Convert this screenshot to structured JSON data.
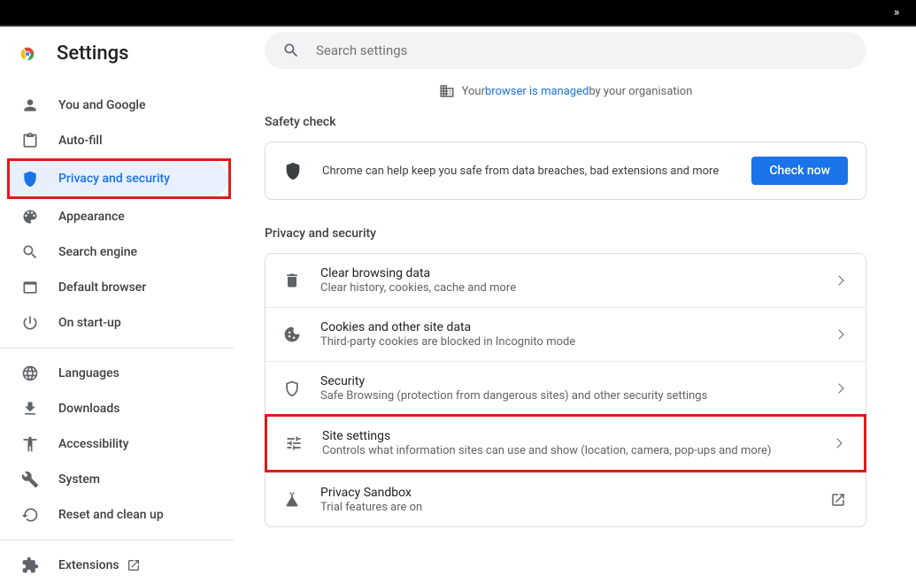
{
  "topbar": {
    "expand": "»"
  },
  "sidebar": {
    "title": "Settings",
    "items": [
      {
        "label": "You and Google"
      },
      {
        "label": "Auto-fill"
      },
      {
        "label": "Privacy and security"
      },
      {
        "label": "Appearance"
      },
      {
        "label": "Search engine"
      },
      {
        "label": "Default browser"
      },
      {
        "label": "On start-up"
      }
    ],
    "items2": [
      {
        "label": "Languages"
      },
      {
        "label": "Downloads"
      },
      {
        "label": "Accessibility"
      },
      {
        "label": "System"
      },
      {
        "label": "Reset and clean up"
      }
    ],
    "extensions": "Extensions"
  },
  "search": {
    "placeholder": "Search settings"
  },
  "managed": {
    "prefix": "Your ",
    "link": "browser is managed",
    "suffix": " by your organisation"
  },
  "safety": {
    "heading": "Safety check",
    "text": "Chrome can help keep you safe from data breaches, bad extensions and more",
    "button": "Check now"
  },
  "privacy": {
    "heading": "Privacy and security",
    "rows": [
      {
        "title": "Clear browsing data",
        "sub": "Clear history, cookies, cache and more"
      },
      {
        "title": "Cookies and other site data",
        "sub": "Third-party cookies are blocked in Incognito mode"
      },
      {
        "title": "Security",
        "sub": "Safe Browsing (protection from dangerous sites) and other security settings"
      },
      {
        "title": "Site settings",
        "sub": "Controls what information sites can use and show (location, camera, pop-ups and more)"
      },
      {
        "title": "Privacy Sandbox",
        "sub": "Trial features are on"
      }
    ]
  }
}
